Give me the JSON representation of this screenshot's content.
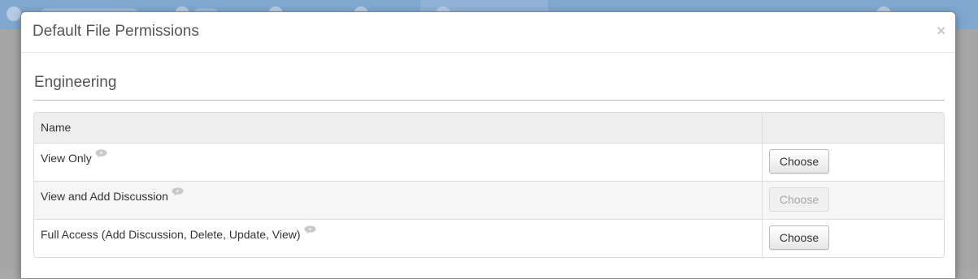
{
  "modal": {
    "title": "Default File Permissions",
    "close_glyph": "×"
  },
  "section": {
    "title": "Engineering"
  },
  "table": {
    "header_name": "Name",
    "rows": [
      {
        "name": "View Only",
        "button_label": "Choose",
        "button_disabled": false
      },
      {
        "name": "View and Add Discussion",
        "button_label": "Choose",
        "button_disabled": true
      },
      {
        "name": "Full Access (Add Discussion, Delete, Update, View)",
        "button_label": "Choose",
        "button_disabled": false
      }
    ]
  },
  "icons": {
    "info": "speech-bubble-icon",
    "close": "close-icon"
  },
  "colors": {
    "overlay_bg": "#a9a9a9",
    "navbar_bg": "#7fa7cf",
    "header_row_bg": "#eeeeee"
  }
}
